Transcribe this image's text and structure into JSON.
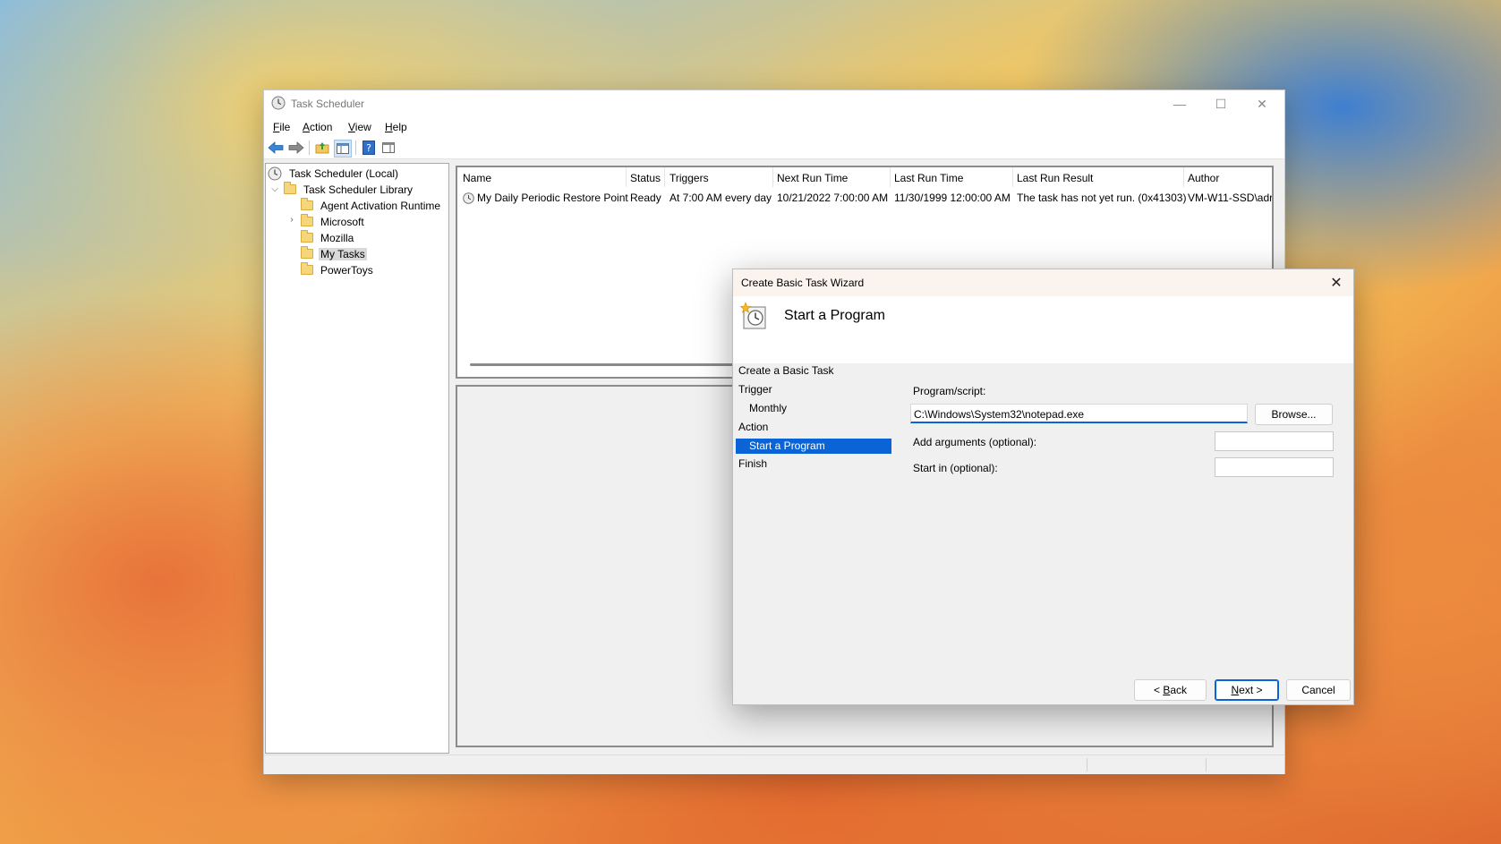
{
  "window": {
    "title": "Task Scheduler",
    "minimize": "—",
    "maximize": "☐",
    "close": "✕"
  },
  "menu": [
    {
      "pre": "",
      "u": "F",
      "post": "ile"
    },
    {
      "pre": "",
      "u": "A",
      "post": "ction"
    },
    {
      "pre": "",
      "u": "V",
      "post": "iew"
    },
    {
      "pre": "",
      "u": "H",
      "post": "elp"
    }
  ],
  "tree": {
    "root": "Task Scheduler (Local)",
    "library": "Task Scheduler Library",
    "folders": [
      "Agent Activation Runtime",
      "Microsoft",
      "Mozilla",
      "My Tasks",
      "PowerToys"
    ],
    "selected": "My Tasks"
  },
  "task_list": {
    "columns": [
      "Name",
      "Status",
      "Triggers",
      "Next Run Time",
      "Last Run Time",
      "Last Run Result",
      "Author"
    ],
    "rows": [
      [
        "My Daily Periodic Restore Point",
        "Ready",
        "At 7:00 AM every day",
        "10/21/2022 7:00:00 AM",
        "11/30/1999 12:00:00 AM",
        "The task has not yet run. (0x41303)",
        "VM-W11-SSD\\adr"
      ]
    ]
  },
  "wizard": {
    "title": "Create Basic Task Wizard",
    "close": "✕",
    "header": "Start a Program",
    "steps": [
      "Create a Basic Task",
      "Trigger",
      "Monthly",
      "Action",
      "Start a Program",
      "Finish"
    ],
    "active_step": "Start a Program",
    "program_label": "Program/script:",
    "program_value": "C:\\Windows\\System32\\notepad.exe",
    "browse": "Browse...",
    "arguments_label": "Add arguments (optional):",
    "arguments_value": "",
    "start_in_label": "Start in (optional):",
    "start_in_value": "",
    "back": "< Back",
    "back_u": "B",
    "next": "Next >",
    "next_u": "N",
    "cancel": "Cancel"
  },
  "colors": {
    "selection_blue": "#0a64d6",
    "dialog_title_bg": "#fbf4ee"
  }
}
